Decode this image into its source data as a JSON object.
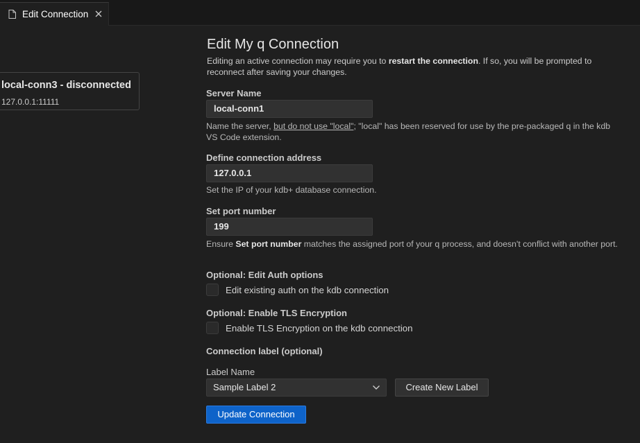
{
  "tab": {
    "title": "Edit Connection"
  },
  "hover_card": {
    "title": "local-conn3 - disconnected",
    "address": "127.0.0.1:11111"
  },
  "form": {
    "title": "Edit My q Connection",
    "desc_pre": "Editing an active connection may require you to ",
    "desc_bold": "restart the connection",
    "desc_post": ". If so, you will be prompted to reconnect after saving your changes.",
    "server_name": {
      "label": "Server Name",
      "value": "local-conn1",
      "help_pre": "Name the server, ",
      "help_underline": "but do not use \"local\"",
      "help_post": "; \"local\" has been reserved for use by the pre-packaged q in the kdb VS Code extension."
    },
    "address": {
      "label": "Define connection address",
      "value": "127.0.0.1",
      "help": "Set the IP of your kdb+ database connection."
    },
    "port": {
      "label": "Set port number",
      "value": "199",
      "help_pre": "Ensure ",
      "help_bold": "Set port number",
      "help_post": " matches the assigned port of your q process, and doesn't conflict with another port."
    },
    "auth": {
      "label": "Optional: Edit Auth options",
      "checkbox_label": "Edit existing auth on the kdb connection",
      "checked": false
    },
    "tls": {
      "label": "Optional: Enable TLS Encryption",
      "checkbox_label": "Enable TLS Encryption on the kdb connection",
      "checked": false
    },
    "connection_label": {
      "heading": "Connection label (optional)",
      "label_name": "Label Name",
      "selected": "Sample Label 2",
      "create_button": "Create New Label"
    },
    "submit": "Update Connection"
  }
}
